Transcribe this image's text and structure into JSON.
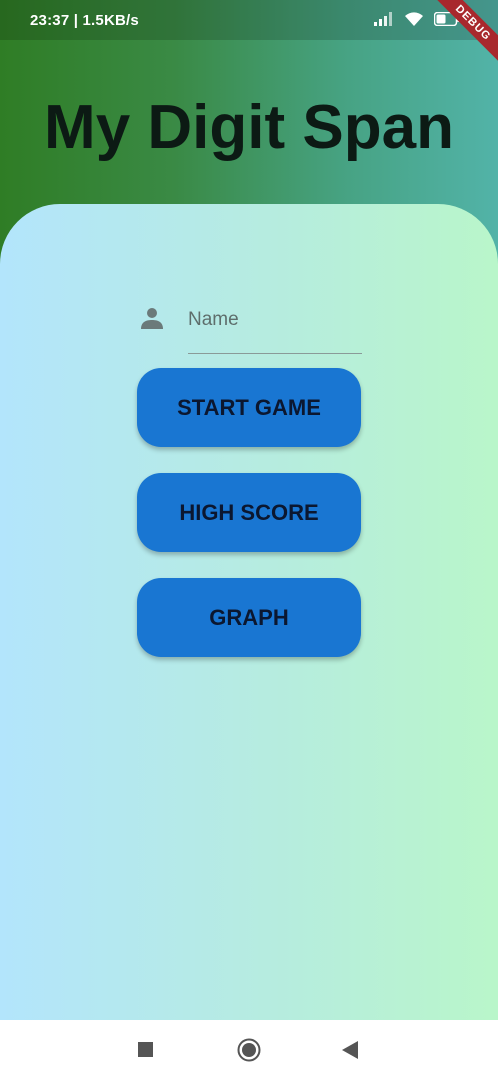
{
  "status_bar": {
    "time_speed": "23:37 | 1.5KB/s",
    "debug_label": "DEBUG"
  },
  "app": {
    "title": "My Digit Span"
  },
  "form": {
    "name_placeholder": "Name",
    "name_value": ""
  },
  "buttons": {
    "start_game": "START GAME",
    "high_score": "HIGH SCORE",
    "graph": "GRAPH"
  },
  "icons": {
    "person": "person-icon",
    "signal": "signal-icon",
    "wifi": "wifi-icon",
    "battery": "battery-icon",
    "recents": "recents-square-icon",
    "home": "home-circle-icon",
    "back": "back-triangle-icon"
  },
  "colors": {
    "header_gradient_start": "#2f7d25",
    "header_gradient_end": "#52b3a8",
    "card_gradient_start": "#b3e5fc",
    "card_gradient_end": "#b9f6ca",
    "button": "#1976d2",
    "debug_banner": "#a8282d"
  }
}
